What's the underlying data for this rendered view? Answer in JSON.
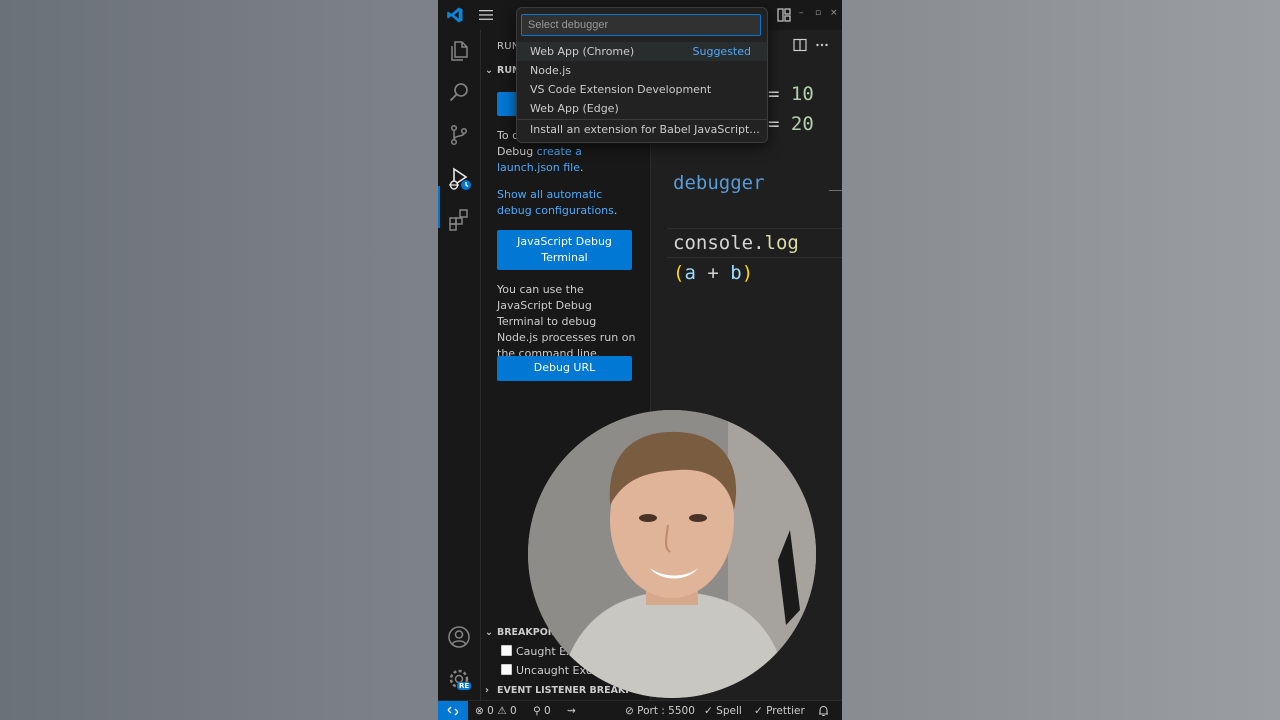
{
  "window": {
    "minimize": "–",
    "restore": "▫",
    "close": "×"
  },
  "sidebar": {
    "header": "RUN AND DEBUG",
    "section_run": "RUN",
    "intro_partial": "To c",
    "intro_line2_prefix": "Debug ",
    "create_launch_link": "create a launch.json file",
    "create_launch_suffix": ".",
    "show_all_link": "Show all automatic debug configurations",
    "show_all_suffix": ".",
    "js_debug_terminal_button": "JavaScript Debug Terminal",
    "terminal_description": "You can use the JavaScript Debug Terminal to debug Node.js processes run on the command line.",
    "debug_url_button": "Debug URL",
    "section_breakpoints": "BREAKPOINTS",
    "caught_exceptions": "Caught Exceptions",
    "uncaught_exceptions": "Uncaught Exceptions",
    "section_event_listener": "EVENT LISTENER BREAKPOINTS"
  },
  "editor": {
    "line1": {
      "op": "= ",
      "value": "10"
    },
    "line2": {
      "op": "= ",
      "value": "20"
    },
    "debugger_kw": "debugger",
    "console": "console",
    "dot": ".",
    "log": "log",
    "paren_open": "(",
    "arg_a": "a",
    "plus": " + ",
    "arg_b": "b",
    "paren_close": ")"
  },
  "quick_pick": {
    "placeholder": "Select debugger",
    "items": [
      {
        "label": "Web App (Chrome)",
        "detail": "Suggested"
      },
      {
        "label": "Node.js"
      },
      {
        "label": "VS Code Extension Development"
      },
      {
        "label": "Web App (Edge)"
      },
      {
        "label": "Install an extension for Babel JavaScript..."
      }
    ]
  },
  "status_bar": {
    "errors": "0",
    "warnings": "0",
    "ports": "0",
    "port": "Port : 5500",
    "spell": "Spell",
    "prettier": "Prettier"
  },
  "activity_bar": {
    "account_badge": "RE"
  },
  "colors": {
    "accent": "#0078d4",
    "link": "#4daafc",
    "keyword": "#569cd6",
    "function": "#dcdcaa",
    "number": "#b5cea8",
    "bracket": "#ffd700"
  },
  "icons": [
    "vscode-logo-icon",
    "menu-icon",
    "layout-icon",
    "explorer-icon",
    "search-icon",
    "source-control-icon",
    "run-debug-icon",
    "extensions-icon",
    "account-icon",
    "gear-icon",
    "split-editor-icon",
    "more-icon",
    "remote-icon",
    "error-icon",
    "warning-icon",
    "ports-icon",
    "broadcast-icon",
    "port-icon",
    "check-icon",
    "bell-icon"
  ]
}
